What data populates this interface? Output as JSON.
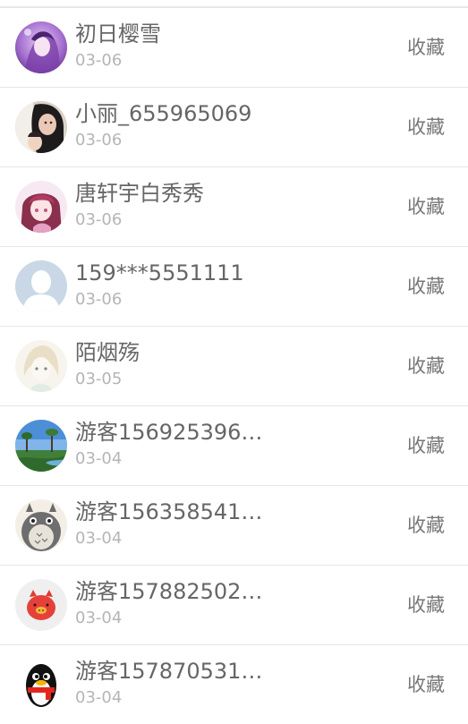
{
  "collect_label": "收藏",
  "rows": [
    {
      "name": "初日樱雪",
      "date": "03-06",
      "avatar": "anime-purple-avatar"
    },
    {
      "name": "小丽_655965069",
      "date": "03-06",
      "avatar": "girl-photo-avatar"
    },
    {
      "name": "唐轩宇白秀秀",
      "date": "03-06",
      "avatar": "anime-pink-avatar"
    },
    {
      "name": "159***5551111",
      "date": "03-06",
      "avatar": "default-person-avatar"
    },
    {
      "name": "陌烟殇",
      "date": "03-05",
      "avatar": "anime-sketch-avatar"
    },
    {
      "name": "游客156925396…",
      "date": "03-04",
      "avatar": "landscape-photo-avatar"
    },
    {
      "name": "游客156358541…",
      "date": "03-04",
      "avatar": "totoro-avatar"
    },
    {
      "name": "游客157882502…",
      "date": "03-04",
      "avatar": "red-pig-avatar"
    },
    {
      "name": "游客157870531…",
      "date": "03-04",
      "avatar": "penguin-avatar"
    }
  ]
}
